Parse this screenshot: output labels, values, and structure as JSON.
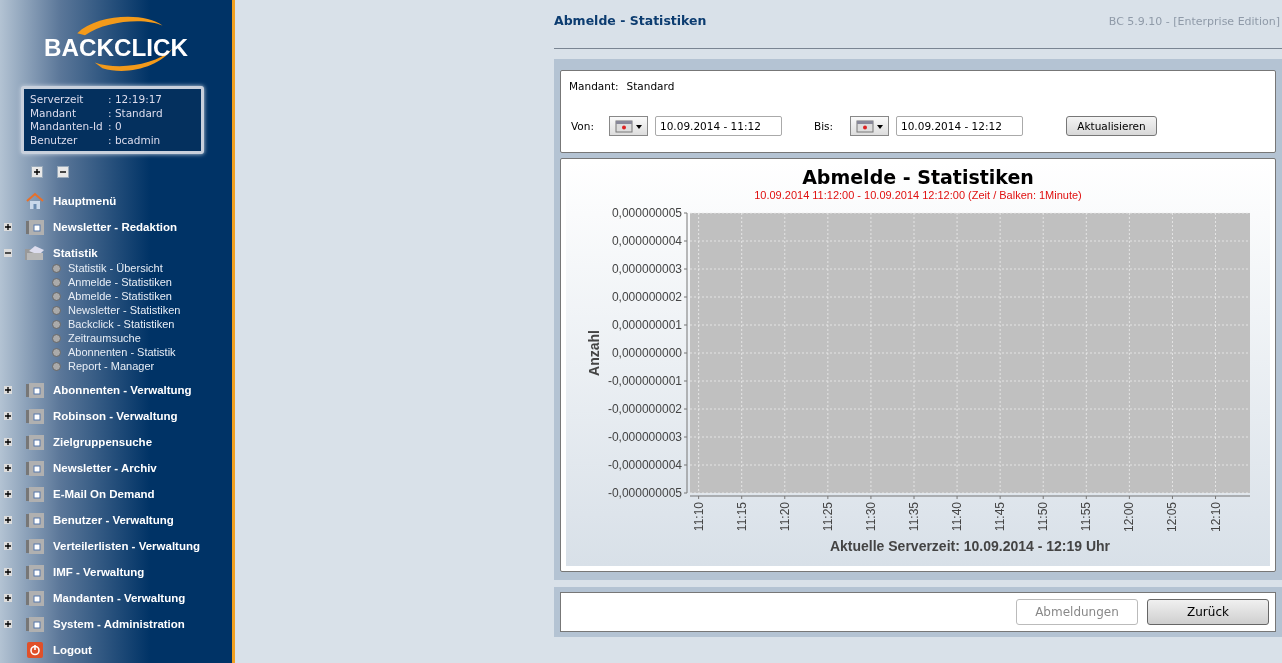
{
  "sidebar": {
    "logo": "BACKCLICK",
    "server_info": [
      {
        "label": "Serverzeit",
        "value": ":  12:19:17"
      },
      {
        "label": "Mandant",
        "value": ": Standard"
      },
      {
        "label": "Mandanten-Id",
        "value": ": 0"
      },
      {
        "label": "Benutzer",
        "value": ": bcadmin"
      }
    ],
    "items": [
      {
        "kind": "home",
        "label": "Hauptmenü"
      },
      {
        "kind": "folder",
        "label": "Newsletter - Redaktion",
        "expanded": false
      },
      {
        "kind": "open-folder",
        "label": "Statistik",
        "expanded": true,
        "children": [
          {
            "label": "Statistik - Übersicht"
          },
          {
            "label": "Anmelde - Statistiken"
          },
          {
            "label": "Abmelde - Statistiken"
          },
          {
            "label": "Newsletter - Statistiken"
          },
          {
            "label": "Backclick - Statistiken"
          },
          {
            "label": "Zeitraumsuche"
          },
          {
            "label": "Abonnenten - Statistik"
          },
          {
            "label": "Report - Manager"
          }
        ]
      },
      {
        "kind": "folder",
        "label": "Abonnenten - Verwaltung",
        "expanded": false
      },
      {
        "kind": "folder",
        "label": "Robinson - Verwaltung",
        "expanded": false
      },
      {
        "kind": "folder",
        "label": "Zielgruppensuche",
        "expanded": false
      },
      {
        "kind": "folder",
        "label": "Newsletter - Archiv",
        "expanded": false
      },
      {
        "kind": "folder",
        "label": "E-Mail On Demand",
        "expanded": false
      },
      {
        "kind": "folder",
        "label": "Benutzer - Verwaltung",
        "expanded": false
      },
      {
        "kind": "folder",
        "label": "Verteilerlisten - Verwaltung",
        "expanded": false
      },
      {
        "kind": "folder",
        "label": "IMF - Verwaltung",
        "expanded": false
      },
      {
        "kind": "folder",
        "label": "Mandanten - Verwaltung",
        "expanded": false
      },
      {
        "kind": "folder",
        "label": "System - Administration",
        "expanded": false
      },
      {
        "kind": "logout",
        "label": "Logout"
      }
    ]
  },
  "page": {
    "title": "Abmelde - Statistiken",
    "version": "BC 5.9.10 - [Enterprise Edition]"
  },
  "form": {
    "mandant_label": "Mandant:",
    "mandant_value": "Standard",
    "from_label": "Von:",
    "from_value": "10.09.2014 - 11:12",
    "to_label": "Bis:",
    "to_value": "10.09.2014 - 12:12",
    "refresh_button": "Aktualisieren"
  },
  "chart": {
    "subtitle": "10.09.2014 11:12:00 - 10.09.2014 12:12:00  (Zeit / Balken: 1Minute)",
    "chart_data": {
      "type": "bar",
      "title": "Abmelde - Statistiken",
      "xlabel": "Aktuelle Serverzeit: 10.09.2014 - 12:19 Uhr",
      "ylabel": "Anzahl",
      "ylim": [
        -5e-09,
        5e-09
      ],
      "grid": true,
      "categories": [
        "11:10",
        "11:15",
        "11:20",
        "11:25",
        "11:30",
        "11:35",
        "11:40",
        "11:45",
        "11:50",
        "11:55",
        "12:00",
        "12:05",
        "12:10"
      ],
      "yticks": [
        {
          "value": 5e-09,
          "label": "0,000000005"
        },
        {
          "value": 4e-09,
          "label": "0,000000004"
        },
        {
          "value": 3e-09,
          "label": "0,000000003"
        },
        {
          "value": 2e-09,
          "label": "0,000000002"
        },
        {
          "value": 1e-09,
          "label": "0,000000001"
        },
        {
          "value": 0,
          "label": "0,000000000"
        },
        {
          "value": -1e-09,
          "label": "-0,000000001"
        },
        {
          "value": -2e-09,
          "label": "-0,000000002"
        },
        {
          "value": -3e-09,
          "label": "-0,000000003"
        },
        {
          "value": -4e-09,
          "label": "-0,000000004"
        },
        {
          "value": -5e-09,
          "label": "-0,000000005"
        }
      ]
    }
  },
  "actions": [
    {
      "label": "Abmeldungen",
      "disabled": true
    },
    {
      "label": "Zurück",
      "disabled": false
    }
  ]
}
